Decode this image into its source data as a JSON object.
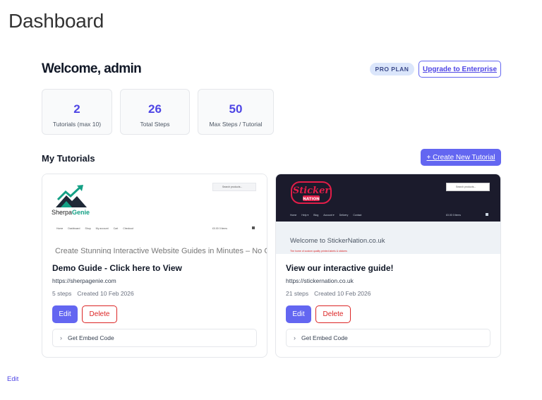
{
  "page": {
    "title": "Dashboard"
  },
  "header": {
    "welcome": "Welcome, admin",
    "plan_badge": "PRO PLAN",
    "upgrade_label": "Upgrade to Enterprise"
  },
  "stats": [
    {
      "value": "2",
      "label": "Tutorials (max 10)"
    },
    {
      "value": "26",
      "label": "Total Steps"
    },
    {
      "value": "50",
      "label": "Max Steps / Tutorial"
    }
  ],
  "tutorials_section": {
    "title": "My Tutorials",
    "create_label": "+ Create New Tutorial"
  },
  "tutorials": [
    {
      "title": "Demo Guide - Click here to View",
      "url": "https://sherpagenie.com",
      "steps": "5 steps",
      "created": "Created 10 Feb 2026",
      "edit_label": "Edit",
      "delete_label": "Delete",
      "embed_label": "Get Embed Code",
      "thumbnail": {
        "brand_prefix": "Sherpa",
        "brand_suffix": "Genie",
        "search_placeholder": "Search products...",
        "nav": [
          "Home",
          "Dashboard",
          "Shop",
          "My account",
          "Cart",
          "Checkout"
        ],
        "price": "£0.00",
        "price_note": "0 items",
        "hero": "Create Stunning Interactive Website Guides in Minutes – No Code"
      }
    },
    {
      "title": "View our interactive guide!",
      "url": "https://stickernation.co.uk",
      "steps": "21 steps",
      "created": "Created 10 Feb 2026",
      "edit_label": "Edit",
      "delete_label": "Delete",
      "embed_label": "Get Embed Code",
      "thumbnail": {
        "logo_top": "Sticker",
        "logo_bottom": "NATION",
        "search_placeholder": "Search products...",
        "nav": [
          "Home",
          "Help ▾",
          "Blog",
          "Account ▾",
          "Delivery",
          "Contact"
        ],
        "price": "£0.00",
        "price_note": "0 items",
        "hero_title": "Welcome to StickerNation.co.uk",
        "hero_sub": "The home of custom quality printed labels & stickers"
      }
    }
  ],
  "footer": {
    "edit_label": "Edit"
  },
  "colors": {
    "accent": "#6366f1",
    "danger": "#dc2626",
    "badge_bg": "#dbe6fb",
    "sherpa_green": "#14a085",
    "sticker_red": "#e11d48"
  }
}
